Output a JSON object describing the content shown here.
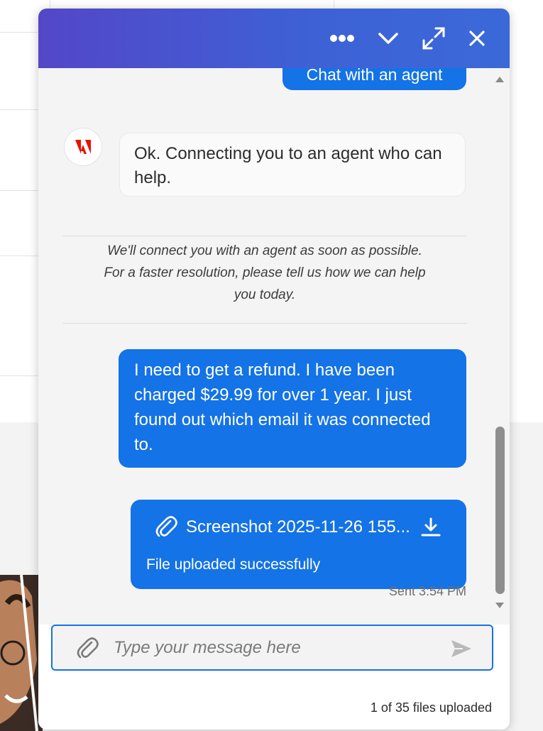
{
  "chat": {
    "header": {
      "more_icon": "more-horizontal-icon",
      "minimize_icon": "chevron-down-icon",
      "expand_icon": "expand-icon",
      "close_icon": "close-icon",
      "gradient_start": "#5347c8",
      "gradient_end": "#3b69d8"
    },
    "messages": [
      {
        "type": "user",
        "text": "Chat with an agent"
      },
      {
        "type": "bot",
        "avatar": "adobe-logo-icon",
        "text": "Ok. Connecting you to an agent who can help."
      },
      {
        "type": "system",
        "lines": [
          "We'll connect you with an agent as soon as possible.",
          "For a faster resolution, please tell us how we can help",
          "you today."
        ]
      },
      {
        "type": "user",
        "text": "I need to get a refund. I have been charged $29.99 for over 1 year. I just found out which email it was connected to."
      },
      {
        "type": "file",
        "filename": "Screenshot 2025-11-26 155...",
        "status": "File uploaded successfully",
        "attach_icon": "paperclip-icon",
        "download_icon": "download-icon"
      }
    ],
    "sent_time": "Sent 3:54 PM",
    "composer": {
      "placeholder": "Type your message here",
      "value": "",
      "attach_icon": "paperclip-icon",
      "send_icon": "send-icon"
    },
    "upload_status": "1 of 35 files uploaded"
  },
  "colors": {
    "accent": "#1473e6",
    "bot_bubble": "#fafafa",
    "messages_bg": "#f4f4f4",
    "adobe_red": "#eb1000"
  }
}
